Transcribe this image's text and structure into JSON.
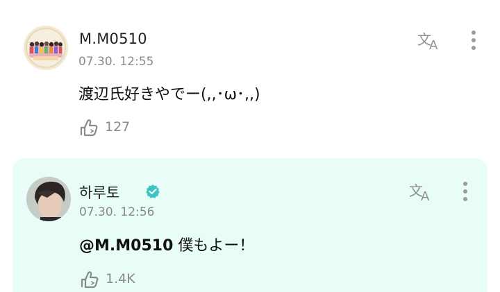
{
  "comments": [
    {
      "username": "M.M0510",
      "verified": false,
      "timestamp": "07.30. 12:55",
      "body": "渡辺氏好きやでー(,,･ω･,,)",
      "likes": "127"
    },
    {
      "username": "하루토",
      "verified": true,
      "timestamp": "07.30. 12:56",
      "mention": "@M.M0510",
      "body": " 僕もよー！",
      "likes": "1.4K"
    }
  ],
  "colors": {
    "reply_background": "#e8fcf8",
    "verified_badge": "#3cc4c4",
    "muted_text": "#8a8a8a"
  },
  "icons": {
    "translate": "translate-icon",
    "more": "more-vertical-icon",
    "like": "like-icon",
    "verified": "verified-badge-icon"
  }
}
